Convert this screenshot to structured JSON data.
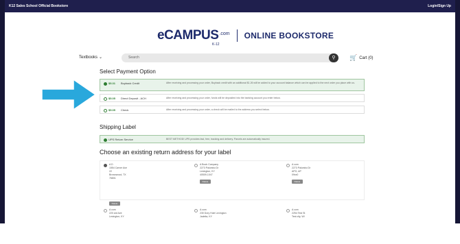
{
  "topbar": {
    "school": "K12 Sales School Official Bookstore",
    "login": "Login/Sign Up"
  },
  "logo": {
    "brand": "eCAMPUS",
    "dotcom": ".com",
    "sub": "K-12",
    "title": "ONLINE BOOKSTORE"
  },
  "nav": {
    "textbooks": "Textbooks",
    "search_placeholder": "Search",
    "cart": "Cart (0)"
  },
  "payment": {
    "heading": "Select Payment Option",
    "options": [
      {
        "amount": "$5.31",
        "name": "Buyback Credit",
        "desc": "After receiving and processing your order, Buyback credit with an additional $1.26 will be added to your account balance which can be applied to the next order you place with us."
      },
      {
        "amount": "$5.05",
        "name": "Direct Deposit - ACH",
        "desc": "After receiving and processing your order, funds will be deposited into the banking account you enter below."
      },
      {
        "amount": "$5.05",
        "name": "Check",
        "desc": "After receiving and processing your order, a check will be mailed to the address you select below."
      }
    ]
  },
  "shipping": {
    "heading": "Shipping Label",
    "option": {
      "name": "UPS Return Service",
      "desc": "BEST METHOD! UPS provides fast, free, tracking and delivery. Parcels are automatically insured."
    }
  },
  "address": {
    "heading": "Choose an existing return address for your label",
    "delete_label": "Delete",
    "cards": [
      {
        "lines": [
          "A D",
          "1554 Carver Ave",
          "22",
          "Brownwood, TX",
          "76801"
        ]
      },
      {
        "lines": [
          "A Book Company",
          "2273 Palumbo Dr",
          "Lexington, KY",
          "40509-1047"
        ]
      },
      {
        "lines": [
          "A com",
          "2273 Palumbo Dr",
          "APO, AP",
          "09xx0"
        ]
      },
      {
        "lines": [
          "A com",
          "220 ard Ave",
          "Lexington, KY"
        ]
      },
      {
        "lines": [
          "A com",
          "230 Dory Hole Lexington",
          "Jadeita, KY"
        ]
      },
      {
        "lines": [
          "A com",
          "2254 Test St",
          "Test city, WI"
        ]
      }
    ]
  },
  "colors": {
    "topbar": "#1f1f4d",
    "accent_arrow": "#29a8dc",
    "green": "#2e7d32",
    "brand": "#1d2a6b"
  }
}
